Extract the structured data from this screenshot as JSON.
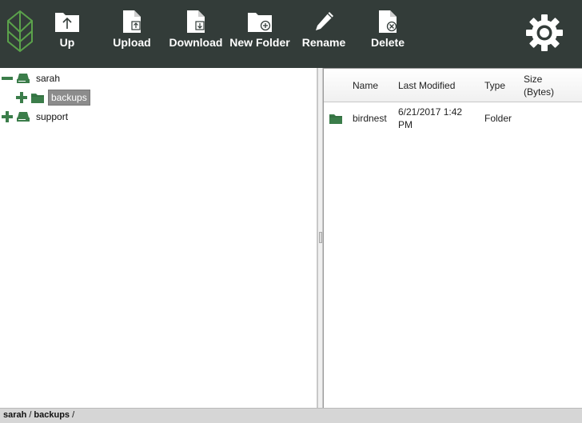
{
  "toolbar": {
    "up_label": "Up",
    "upload_label": "Upload",
    "download_label": "Download",
    "new_folder_label": "New Folder",
    "rename_label": "Rename",
    "delete_label": "Delete"
  },
  "tree": {
    "items": [
      {
        "label": "sarah",
        "expanded": true,
        "icon": "drive-icon"
      },
      {
        "label": "backups",
        "expanded": false,
        "selected": true,
        "icon": "folder-icon"
      },
      {
        "label": "support",
        "expanded": false,
        "icon": "drive-icon"
      }
    ]
  },
  "file_list": {
    "columns": {
      "name": "Name",
      "last_modified": "Last Modified",
      "type": "Type",
      "size_line1": "Size",
      "size_line2": "(Bytes)"
    },
    "rows": [
      {
        "icon": "folder-icon",
        "name": "birdnest",
        "modified_line1": "6/21/2017 1:42",
        "modified_line2": "PM",
        "type": "Folder",
        "size": ""
      }
    ]
  },
  "breadcrumb": {
    "items": [
      "sarah",
      "backups"
    ],
    "separator": "/"
  },
  "colors": {
    "toolbar_bg": "#333c39",
    "accent_green": "#3b7d4a",
    "logo_green": "#5ba24b",
    "selection_bg": "#8c8c8c"
  }
}
